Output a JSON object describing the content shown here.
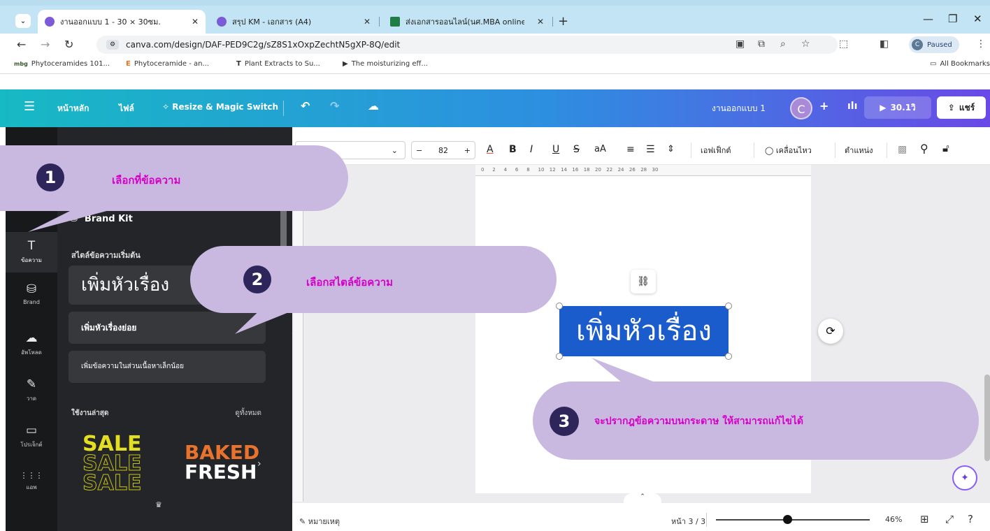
{
  "browser": {
    "tabs": [
      {
        "title": "งานออกแบบ 1 - 30 × 30ซม.",
        "active": true
      },
      {
        "title": "สรุป KM - เอกสาร (A4)",
        "active": false
      },
      {
        "title": "ส่งเอกสารออนไลน์(นศ.MBA online",
        "active": false
      }
    ],
    "url": "canva.com/design/DAF-PED9C2g/sZ8S1xOxpZechtN5gXP-8Q/edit",
    "profile_status": "Paused",
    "profile_initial": "C",
    "bookmarks": [
      {
        "icon": "mbg",
        "label": "Phytoceramides 101..."
      },
      {
        "icon": "E",
        "label": "Phytoceramide - an..."
      },
      {
        "icon": "T",
        "label": "Plant Extracts to Su..."
      },
      {
        "icon": "▶",
        "label": "The moisturizing eff..."
      }
    ],
    "all_bookmarks": "All Bookmarks"
  },
  "canva_header": {
    "home": "หน้าหลัก",
    "file": "ไฟล์",
    "resize": "Resize & Magic Switch",
    "doc_title": "งานออกแบบ 1",
    "avatar": "C",
    "play_time": "30.1วิ",
    "share": "แชร์"
  },
  "rail": [
    {
      "icon": "T",
      "label": "ข้อความ",
      "selected": true
    },
    {
      "icon": "⛁",
      "label": "Brand",
      "selected": false
    },
    {
      "icon": "☁",
      "label": "อัพโหลด",
      "selected": false
    },
    {
      "icon": "✎",
      "label": "วาด",
      "selected": false
    },
    {
      "icon": "▭",
      "label": "โปรเจ็กต์",
      "selected": false
    },
    {
      "icon": "⋮⋮⋮",
      "label": "แอพ",
      "selected": false
    }
  ],
  "panel": {
    "brand_kit": "Brand Kit",
    "default_styles_title": "สไตล์ข้อความเริ่มต้น",
    "heading": "เพิ่มหัวเรื่อง",
    "subheading": "เพิ่มหัวเรื่องย่อย",
    "body": "เพิ่มข้อความในส่วนเนื้อหาเล็กน้อย",
    "recent_title": "ใช้งานล่าสุด",
    "see_all": "ดูทั้งหมด",
    "sale": "SALE",
    "baked": "BAKED",
    "fresh": "FRESH"
  },
  "toolbar": {
    "font_size": "82",
    "effects": "เอฟเฟ็กต์",
    "animate": "เคลื่อนไหว",
    "position": "ตำแหน่ง",
    "aA": "aA"
  },
  "ruler_ticks": [
    "0",
    "2",
    "4",
    "6",
    "8",
    "10",
    "12",
    "14",
    "16",
    "18",
    "20",
    "22",
    "24",
    "26",
    "28",
    "30"
  ],
  "canvas": {
    "text": "เพิ่มหัวเรื่อง"
  },
  "bottom": {
    "notes": "หมายเหตุ",
    "page": "หน้า 3 / 3",
    "zoom": "46%",
    "zoom_level": 0.46
  },
  "annotations": [
    {
      "num": "1",
      "text": "เลือกที่ข้อความ"
    },
    {
      "num": "2",
      "text": "เลือกสไตล์ข้อความ"
    },
    {
      "num": "3",
      "text": "จะปรากฎข้อความบนกระดาษ ให้สามารถแก้ไขได้"
    }
  ]
}
